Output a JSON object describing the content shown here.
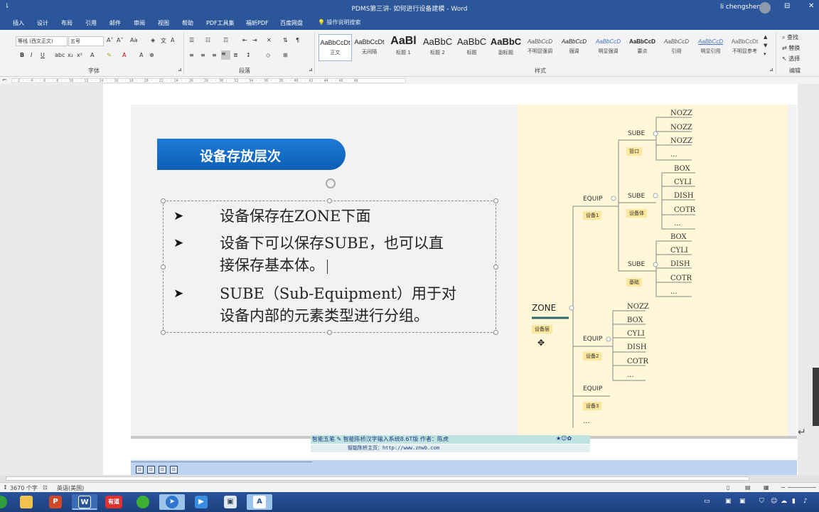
{
  "window": {
    "title": "PDMS第三讲- 如何进行设备建模 - Word",
    "user": "li chengsheng",
    "quick_access": "⇂"
  },
  "tabs": [
    "插入",
    "设计",
    "布局",
    "引用",
    "邮件",
    "审阅",
    "视图",
    "帮助",
    "PDF工具集",
    "福昕PDF",
    "百度网盘"
  ],
  "tell_me": "操作说明搜索",
  "ribbon": {
    "font_name": "等线 (西文正文)",
    "font_size": "五号",
    "font_group_label": "字体",
    "paragraph_group_label": "段落",
    "styles_group_label": "样式",
    "editing_group_label": "编辑",
    "styles": [
      {
        "sample": "AaBbCcDt",
        "name": "正文"
      },
      {
        "sample": "AaBbCcDt",
        "name": "无间隔"
      },
      {
        "sample": "AaBl",
        "name": "标题 1"
      },
      {
        "sample": "AaBbC",
        "name": "标题 2"
      },
      {
        "sample": "AaBbC",
        "name": "标题"
      },
      {
        "sample": "AaBbC",
        "name": "副标题"
      },
      {
        "sample": "AaBbCcD",
        "name": "不明显强调"
      },
      {
        "sample": "AaBbCcD",
        "name": "强调"
      },
      {
        "sample": "AaBbCcD",
        "name": "明显强调"
      },
      {
        "sample": "AaBbCcD",
        "name": "要点"
      },
      {
        "sample": "AaBbCcD",
        "name": "引用"
      },
      {
        "sample": "AaBbCcD",
        "name": "明显引用"
      },
      {
        "sample": "AaBbCcDt",
        "name": "不明显参考"
      }
    ],
    "editing": {
      "find": "查找",
      "replace": "替换",
      "select": "选择"
    }
  },
  "slide": {
    "title": "设备存放层次",
    "bullets": [
      [
        "设备保存在ZONE下面"
      ],
      [
        "设备下可以保存SUBE，也可以直",
        "接保存基本体。"
      ],
      [
        "SUBE（Sub-Equipment）用于对",
        "设备内部的元素类型进行分组。"
      ]
    ]
  },
  "mindmap": {
    "zone": {
      "label": "ZONE",
      "tag": "设备层"
    },
    "equip": [
      {
        "label": "EQUIP",
        "tag": "设备1",
        "subes": [
          {
            "label": "SUBE",
            "tag": "管口",
            "leaves": [
              "NOZZ",
              "NOZZ",
              "NOZZ",
              "..."
            ]
          },
          {
            "label": "SUBE",
            "tag": "设备体",
            "leaves": [
              "BOX",
              "CYLI",
              "DISH",
              "COTR",
              "..."
            ]
          },
          {
            "label": "SUBE",
            "tag": "基础",
            "leaves": [
              "BOX",
              "CYLI",
              "DISH",
              "COTR",
              "..."
            ]
          }
        ]
      },
      {
        "label": "EQUIP",
        "tag": "设备2",
        "leaves": [
          "NOZZ",
          "BOX",
          "CYLI",
          "DISH",
          "COTR",
          "..."
        ]
      },
      {
        "label": "EQUIP",
        "tag": "设备3"
      }
    ],
    "more": "..."
  },
  "ime": {
    "line1_name": "智能五笔",
    "line1_text": "智能陈桥汉字输入系统8.6T版  作者：陈虎",
    "line2": "智能陈桥主页：http://www.znwb.com"
  },
  "status": {
    "words": "3670 个字",
    "lang": "英语(美国)"
  },
  "taskbar": {
    "youdao": "有道"
  },
  "colors": {
    "word_blue": "#2b579a",
    "slide_title_blue": "#0b5fb5",
    "mindmap_bg": "#fff7d8"
  }
}
